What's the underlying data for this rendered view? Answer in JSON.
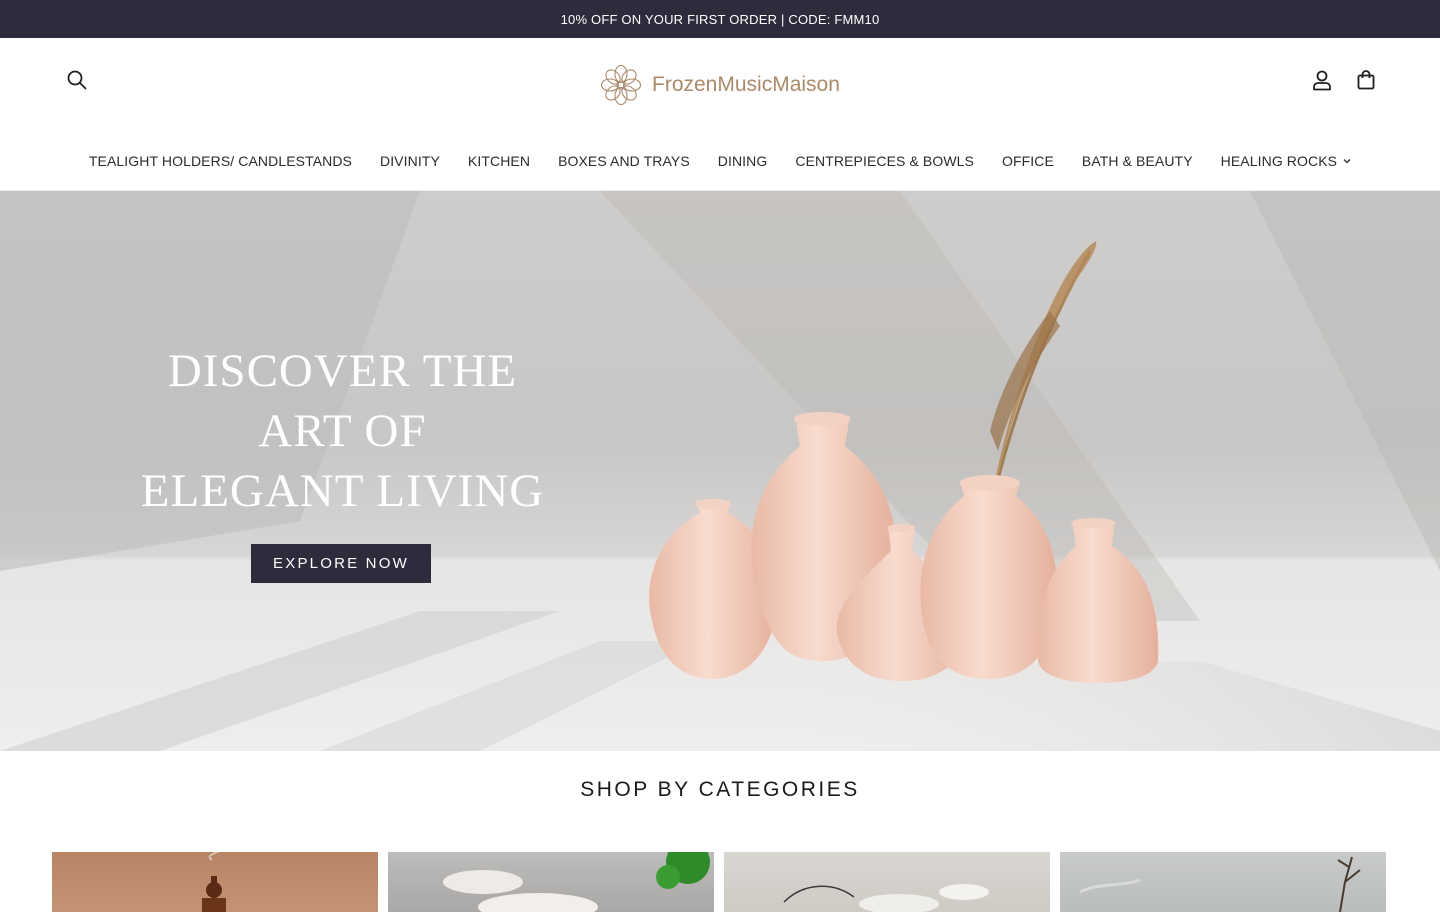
{
  "announcement": "10% OFF ON YOUR FIRST ORDER | CODE: FMM10",
  "brand": {
    "name": "FrozenMusicMaison"
  },
  "header_icons": {
    "search": "search-icon",
    "account": "user-icon",
    "cart": "bag-icon"
  },
  "nav": {
    "items": [
      {
        "label": "TEALIGHT HOLDERS/ CANDLESTANDS"
      },
      {
        "label": "DIVINITY"
      },
      {
        "label": "KITCHEN"
      },
      {
        "label": "BOXES AND TRAYS"
      },
      {
        "label": "DINING"
      },
      {
        "label": "CENTREPIECES & BOWLS"
      },
      {
        "label": "OFFICE"
      },
      {
        "label": "BATH & BEAUTY"
      },
      {
        "label": "HEALING ROCKS",
        "has_dropdown": true
      }
    ]
  },
  "hero": {
    "line1": "DISCOVER THE",
    "line2": "ART OF",
    "line3": "ELEGANT LIVING",
    "cta": "EXPLORE NOW"
  },
  "categories_section": {
    "title": "SHOP BY CATEGORIES"
  },
  "colors": {
    "dark": "#2c2c3d",
    "brand": "#a98a6a",
    "vase": "#f1cfc2"
  }
}
